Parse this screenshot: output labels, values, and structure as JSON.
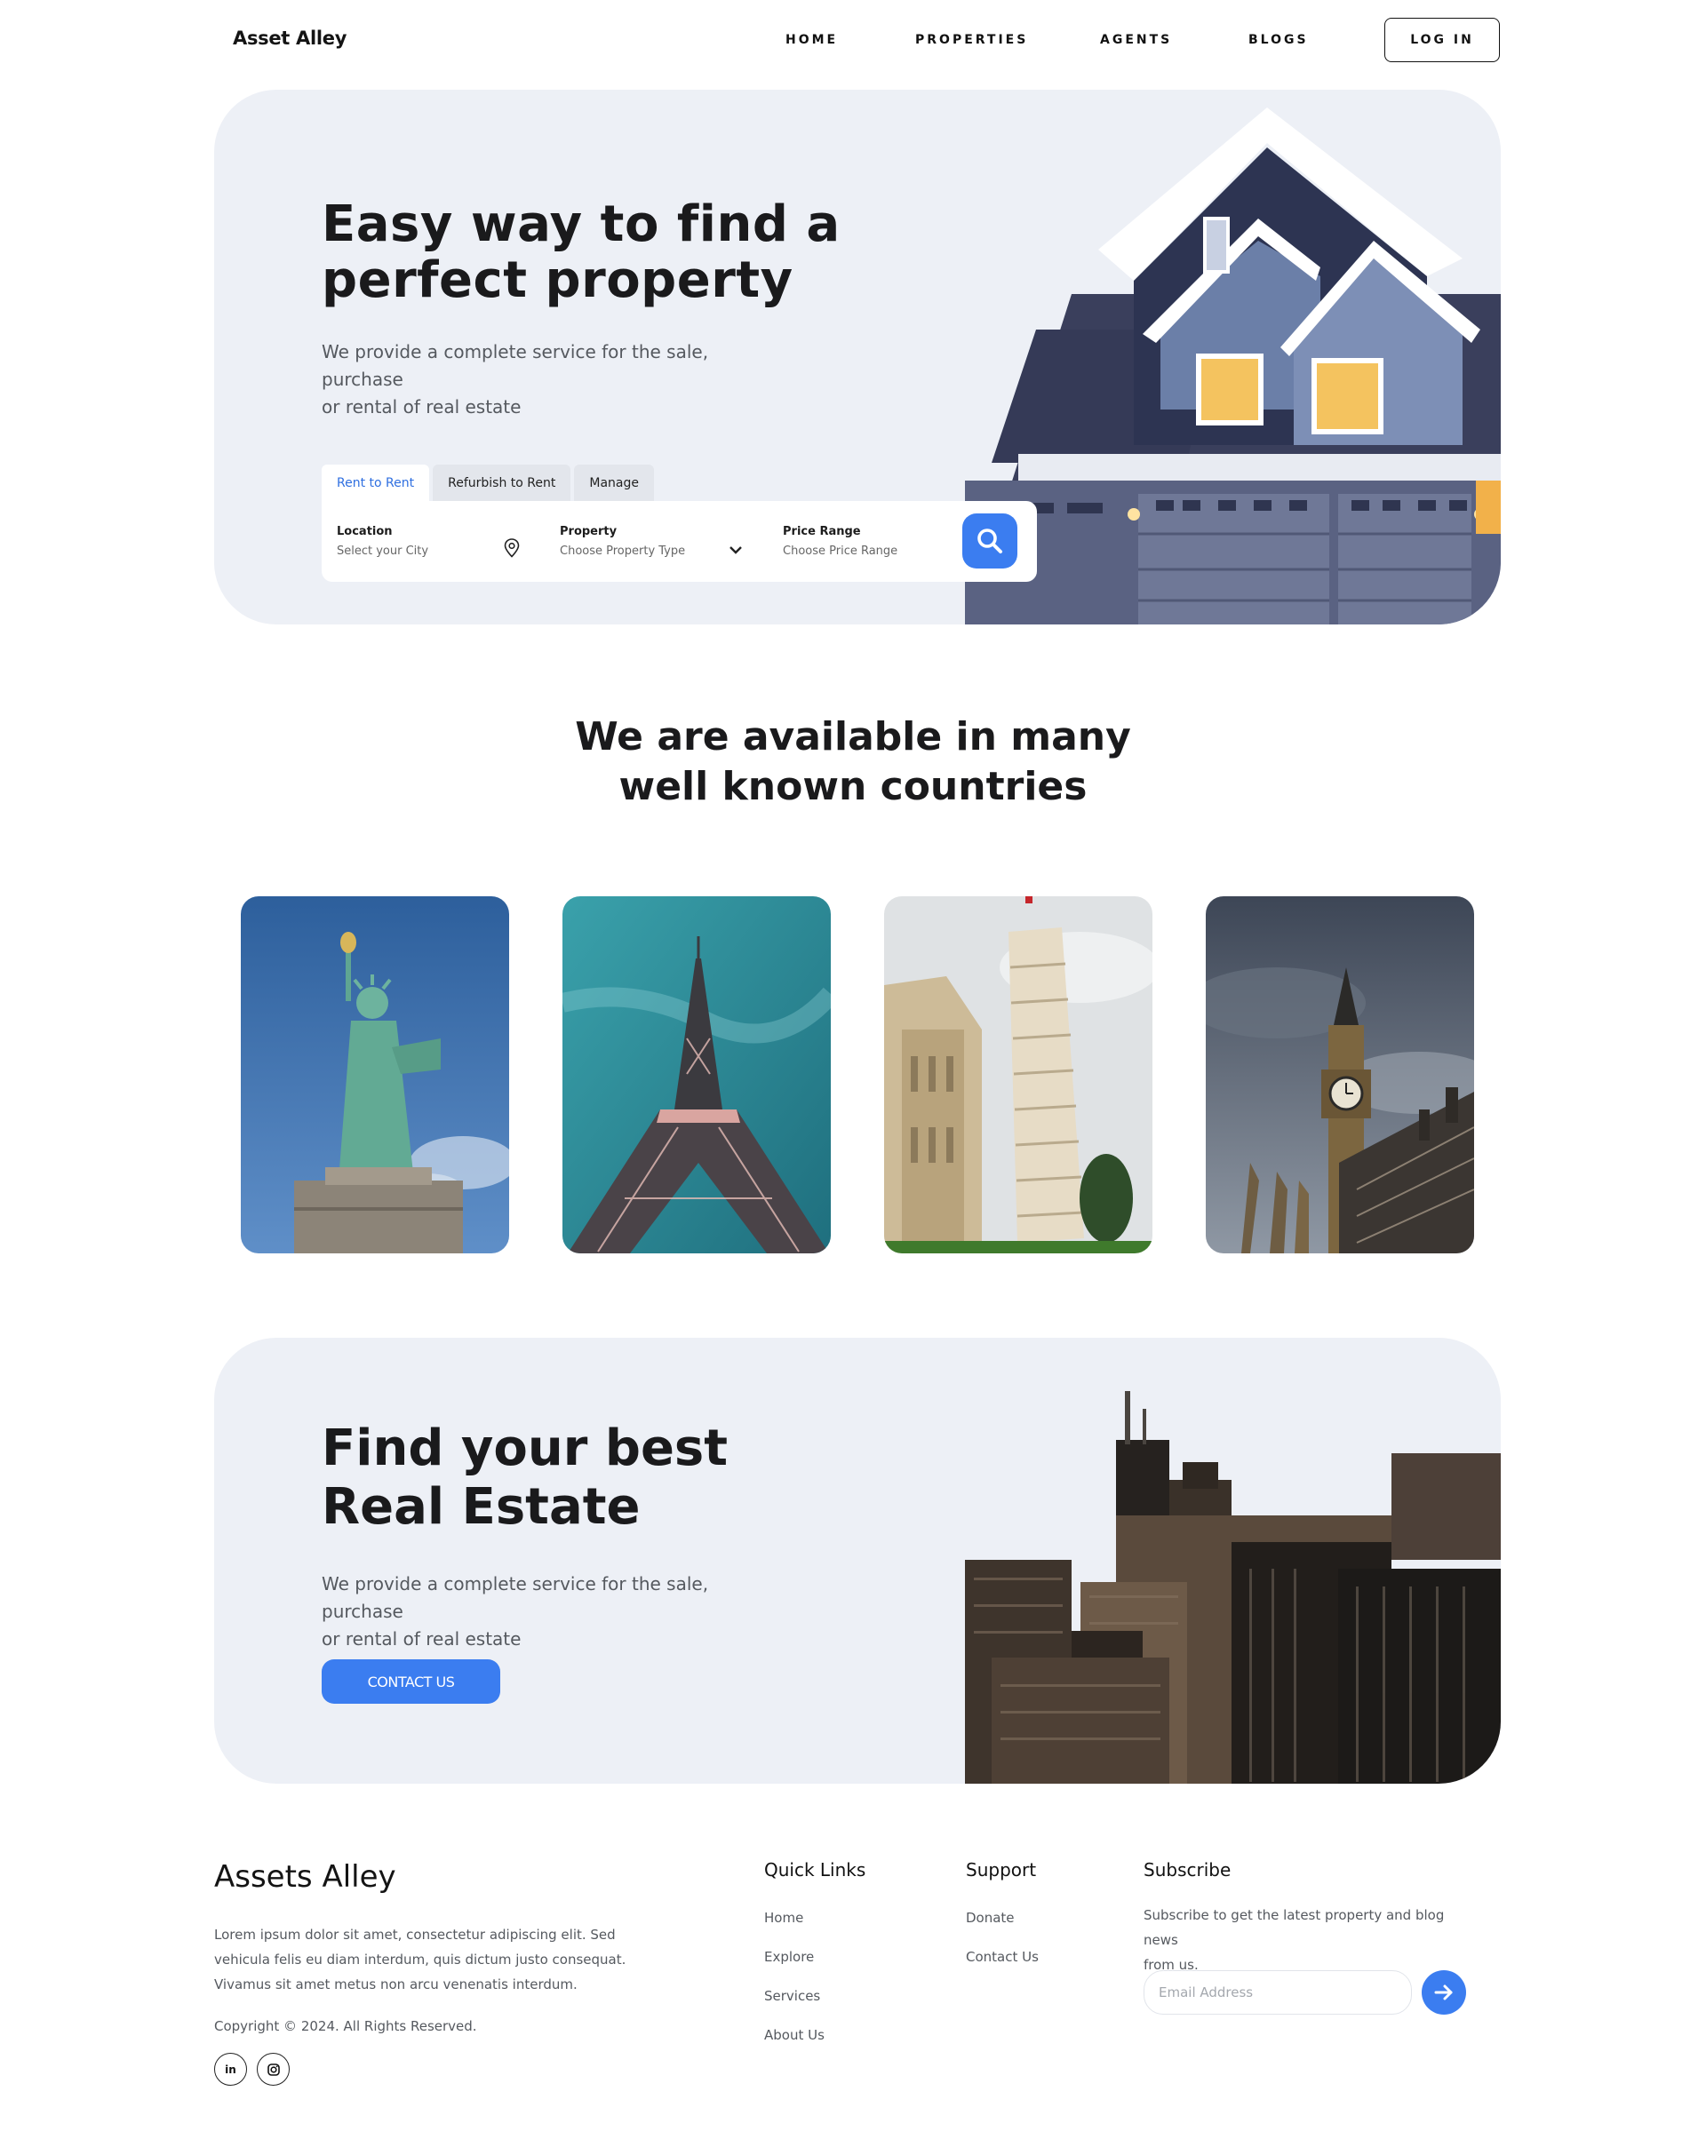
{
  "nav": {
    "brand": "Asset Alley",
    "links": [
      "HOME",
      "PROPERTIES",
      "AGENTS",
      "BLOGS"
    ],
    "login": "LOG IN"
  },
  "hero": {
    "title_line1": "Easy way to find a",
    "title_line2": "perfect property",
    "subtitle_line1": "We provide a complete service for the sale, purchase",
    "subtitle_line2": "or rental of real estate",
    "tabs": [
      "Rent to Rent",
      "Refurbish to Rent",
      "Manage"
    ],
    "active_tab": "Rent to Rent",
    "search": {
      "location_label": "Location",
      "location_value": "Select your City",
      "property_label": "Property",
      "property_value": "Choose Property Type",
      "price_label": "Price Range",
      "price_value": "Choose Price Range"
    }
  },
  "countries": {
    "title_line1": "We are available in many",
    "title_line2": "well known countries",
    "cards": [
      "statue-of-liberty",
      "eiffel-tower",
      "leaning-tower-of-pisa",
      "big-ben"
    ]
  },
  "realestate": {
    "title_line1": "Find your best",
    "title_line2": "Real Estate",
    "subtitle_line1": "We provide a complete service for the sale, purchase",
    "subtitle_line2": "or rental of real estate",
    "button": "CONTACT US"
  },
  "footer": {
    "brand": "Assets Alley",
    "desc_line1": "Lorem ipsum dolor sit amet, consectetur adipiscing elit. Sed",
    "desc_line2": "vehicula felis eu diam interdum, quis dictum justo consequat.",
    "desc_line3": "Vivamus sit amet metus non arcu venenatis interdum.",
    "copyright": "Copyright © 2024. All Rights Reserved.",
    "social": [
      "in",
      "◎"
    ],
    "quick_links": {
      "title": "Quick Links",
      "items": [
        "Home",
        "Explore",
        "Services",
        "About Us"
      ]
    },
    "support": {
      "title": "Support",
      "items": [
        "Donate",
        "Contact Us"
      ]
    },
    "subscribe": {
      "title": "Subscribe",
      "text_line1": "Subscribe to get the latest property and blog news",
      "text_line2": "from us.",
      "placeholder": "Email Address"
    }
  },
  "colors": {
    "accent": "#3b7df0",
    "panel": "#edf0f6",
    "text": "#141414",
    "muted": "#55595f"
  }
}
